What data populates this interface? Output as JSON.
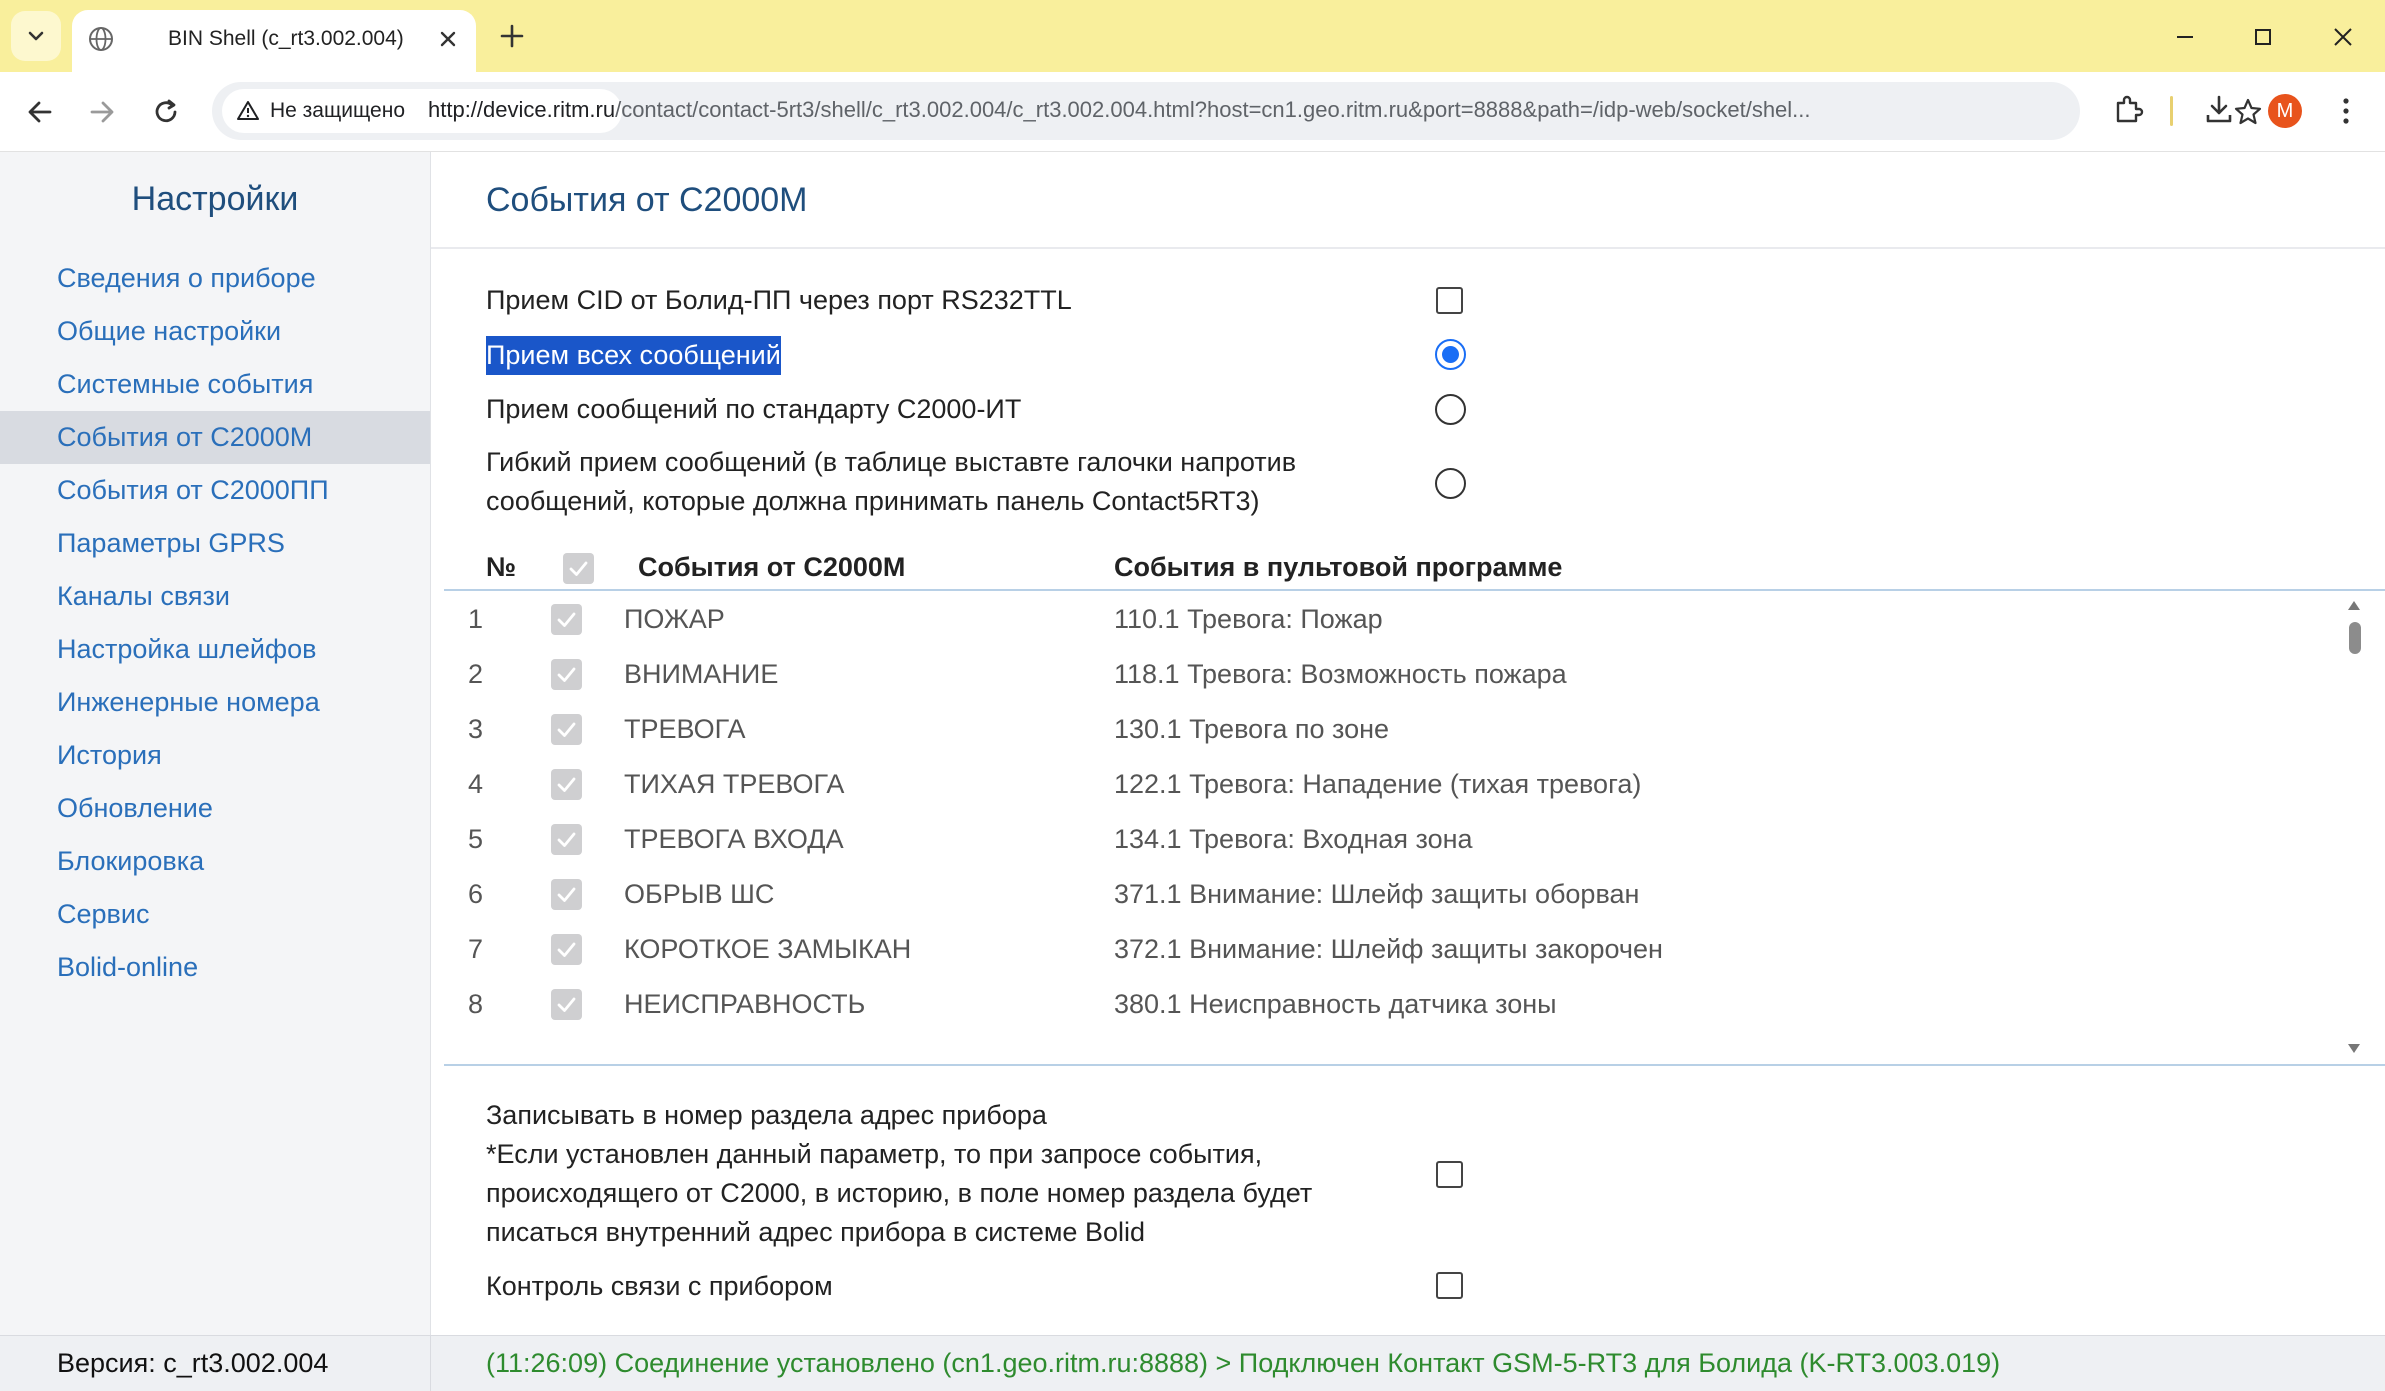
{
  "browser": {
    "tab_title": "BIN Shell (c_rt3.002.004)",
    "security_label": "Не защищено",
    "url_host": "http://device.ritm.ru",
    "url_rest": "/contact/contact-5rt3/shell/c_rt3.002.004/c_rt3.002.004.html?host=cn1.geo.ritm.ru&port=8888&path=/idp-web/socket/shel...",
    "avatar_letter": "M",
    "titlebar_color": "#f9ef9c"
  },
  "sidebar": {
    "title": "Настройки",
    "items": [
      {
        "label": "Сведения о приборе"
      },
      {
        "label": "Общие настройки"
      },
      {
        "label": "Системные события"
      },
      {
        "label": "События от С2000М"
      },
      {
        "label": "События от С2000ПП"
      },
      {
        "label": "Параметры GPRS"
      },
      {
        "label": "Каналы связи"
      },
      {
        "label": "Настройка шлейфов"
      },
      {
        "label": "Инженерные номера"
      },
      {
        "label": "История"
      },
      {
        "label": "Обновление"
      },
      {
        "label": "Блокировка"
      },
      {
        "label": "Сервис"
      },
      {
        "label": "Bolid-online"
      }
    ],
    "active_index": 3
  },
  "main": {
    "page_title": "События от С2000М",
    "option_cid": "Прием CID от Болид-ПП через порт RS232TTL",
    "option_all": "Прием всех сообщений",
    "option_standard": "Прием сообщений по стандарту С2000-ИТ",
    "option_flex_line1": "Гибкий прием сообщений (в таблице выставте галочки напротив",
    "option_flex_line2": "сообщений, которые должна принимать панель Contact5RT3)",
    "selected_mode": "all",
    "table": {
      "col_num": "№",
      "col_events": "События от С2000М",
      "col_cms": "События в пультовой программе",
      "rows": [
        {
          "num": "1",
          "event": "ПОЖАР",
          "cms": "110.1 Тревога: Пожар"
        },
        {
          "num": "2",
          "event": "ВНИМАНИЕ",
          "cms": "118.1 Тревога: Возможность пожара"
        },
        {
          "num": "3",
          "event": "ТРЕВОГА",
          "cms": "130.1 Тревога по зоне"
        },
        {
          "num": "4",
          "event": "ТИХАЯ ТРЕВОГА",
          "cms": "122.1 Тревога: Нападение (тихая тревога)"
        },
        {
          "num": "5",
          "event": "ТРЕВОГА ВХОДА",
          "cms": "134.1 Тревога: Входная зона"
        },
        {
          "num": "6",
          "event": "ОБРЫВ ШС",
          "cms": "371.1 Внимание: Шлейф защиты оборван"
        },
        {
          "num": "7",
          "event": "КОРОТКОЕ ЗАМЫКАН",
          "cms": "372.1 Внимание: Шлейф защиты закорочен"
        },
        {
          "num": "8",
          "event": "НЕИСПРАВНОСТЬ",
          "cms": "380.1 Неисправность датчика зоны"
        }
      ]
    },
    "opt_address_line1": "Записывать в номер раздела адрес прибора",
    "opt_address_line2": "*Если установлен данный параметр, то при запросе события,",
    "opt_address_line3": "происходящего от С2000, в историю, в поле номер раздела будет",
    "opt_address_line4": "писаться внутренний адрес прибора в системе Bolid",
    "opt_link_control": "Контроль связи с прибором"
  },
  "status": {
    "version": "Версия: c_rt3.002.004",
    "message": "(11:26:09) Соединение установлено (cn1.geo.ritm.ru:8888) > Подключен Контакт GSM-5-RT3 для Болида (K-RT3.003.019)"
  }
}
